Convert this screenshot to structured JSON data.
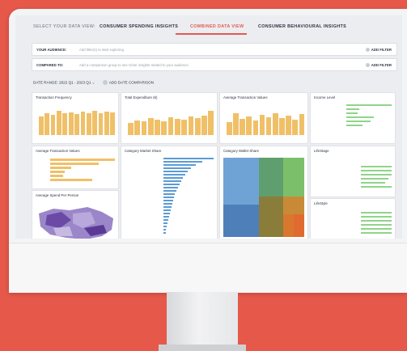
{
  "tabs": {
    "label": "SELECT YOUR DATA VIEW:",
    "items": [
      "CONSUMER SPENDING INSIGHTS",
      "COMBINED DATA VIEW",
      "CONSUMER BEHAVIOURAL INSIGHTS"
    ],
    "active": 1
  },
  "audience": {
    "label": "YOUR AUDIENCE:",
    "placeholder": "Add filter(s) to start exploring",
    "add": "ADD FILTER"
  },
  "compared": {
    "label": "COMPARED TO:",
    "placeholder": "Add a comparison group to see richer insights related to your audience",
    "add": "ADD FILTER"
  },
  "date": {
    "label": "DATE RANGE: 2022 Q1 - 2023 Q1",
    "add": "ADD DATE COMPARISON"
  },
  "panels": {
    "p1": "Transaction Frequency",
    "p2": "Total Expenditure (€)",
    "p3": "Average Transaction Values",
    "p4": "Income Level",
    "p5": "Average Transaction Values",
    "p6": "Category Market Share",
    "p7": "Category Wallet Share",
    "p8": "LifeStage",
    "p9": "Average Spend Per Person",
    "p10": "LifeStyle"
  },
  "colors": {
    "accent": "#e45a4f",
    "bar": "#f0c068",
    "blue": "#5b9bd5",
    "green": "#8fd48a",
    "purple": "#7a5fb0"
  }
}
